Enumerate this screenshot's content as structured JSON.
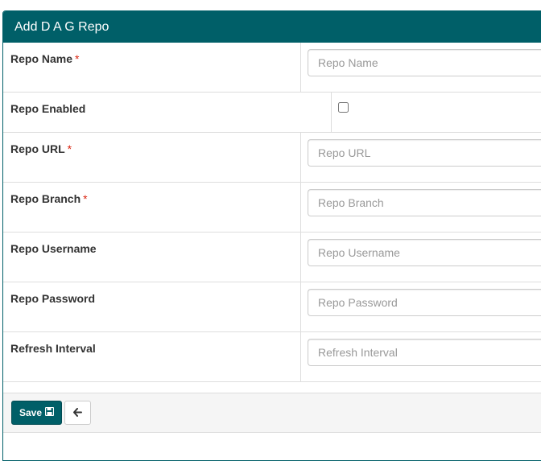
{
  "panel": {
    "title": "Add D A G Repo"
  },
  "fields": [
    {
      "label": "Repo Name",
      "required": "*",
      "placeholder": "Repo Name",
      "type": "text"
    },
    {
      "label": "Repo Enabled",
      "type": "checkbox",
      "checked": false
    },
    {
      "label": "Repo URL",
      "required": "*",
      "placeholder": "Repo URL",
      "type": "text"
    },
    {
      "label": "Repo Branch",
      "required": "*",
      "placeholder": "Repo Branch",
      "type": "text"
    },
    {
      "label": "Repo Username",
      "placeholder": "Repo Username",
      "type": "text"
    },
    {
      "label": "Repo Password",
      "placeholder": "Repo Password",
      "type": "password"
    },
    {
      "label": "Refresh Interval",
      "placeholder": "Refresh Interval",
      "type": "text"
    }
  ],
  "footer": {
    "save_label": "Save",
    "save_icon": "floppy-disk-icon",
    "back_icon": "arrow-left-icon"
  },
  "colors": {
    "header_bg": "#005f68",
    "save_bg": "#005f68",
    "required": "#d9230f"
  }
}
